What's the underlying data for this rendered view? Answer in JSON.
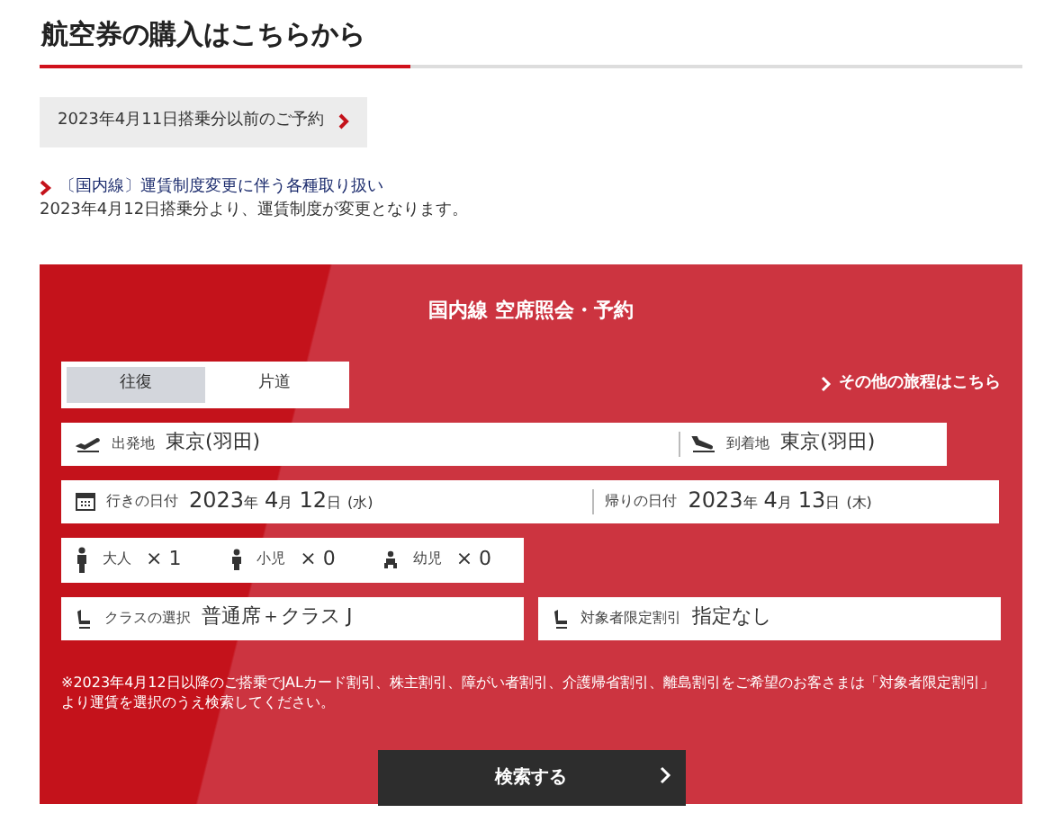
{
  "heading": "航空券の購入はこちらから",
  "previous_booking": {
    "label": "2023年4月11日搭乗分以前のご予約"
  },
  "notice": {
    "link": "〔国内線〕運賃制度変更に伴う各種取り扱い",
    "text": "2023年4月12日搭乗分より、運賃制度が変更となります。"
  },
  "panel": {
    "title": "国内線 空席照会・予約",
    "trip_tabs": [
      {
        "label": "往復",
        "selected": true
      },
      {
        "label": "片道",
        "selected": false
      }
    ],
    "other_itinerary_link": "その他の旅程はこちら",
    "departure": {
      "label": "出発地",
      "value": "東京(羽田)"
    },
    "arrival": {
      "label": "到着地",
      "value": "東京(羽田)"
    },
    "outbound_date": {
      "label": "行きの日付",
      "parts": [
        "2023",
        "年",
        "4",
        "月",
        "12",
        "日",
        "(水)"
      ]
    },
    "return_date": {
      "label": "帰りの日付",
      "parts": [
        "2023",
        "年",
        "4",
        "月",
        "13",
        "日",
        "(木)"
      ]
    },
    "passengers": [
      {
        "kind": "adult",
        "label": "大人",
        "count": "× 1"
      },
      {
        "kind": "child",
        "label": "小児",
        "count": "× 0"
      },
      {
        "kind": "infant",
        "label": "幼児",
        "count": "× 0"
      }
    ],
    "class": {
      "label": "クラスの選択",
      "value": "普通席＋クラス J"
    },
    "discount": {
      "label": "対象者限定割引",
      "value": "指定なし"
    },
    "note": "※2023年4月12日以降のご搭乗でJALカード割引、株主割引、障がい者割引、介護帰省割引、離島割引をご希望のお客さまは「対象者限定割引」より運賃を選択のうえ検索してください。",
    "search_button": "検索する"
  }
}
